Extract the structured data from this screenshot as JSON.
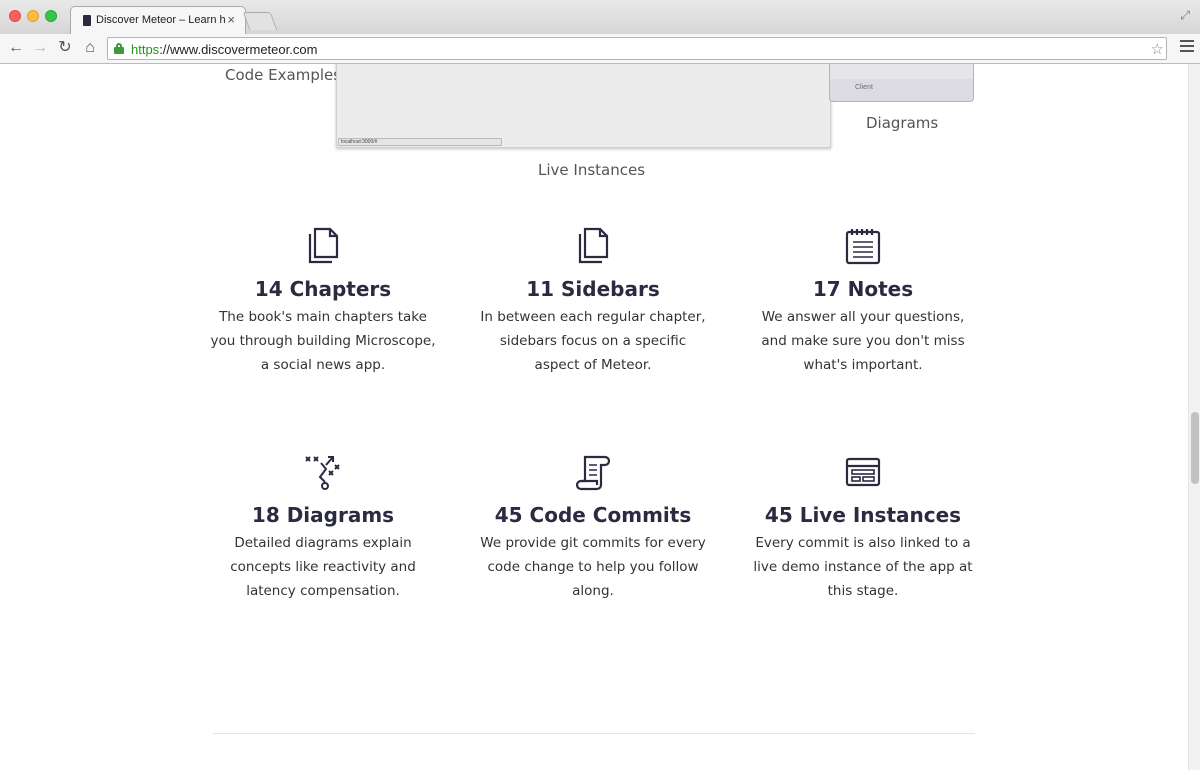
{
  "browser": {
    "tab_title": "Discover Meteor – Learn how",
    "url_scheme": "https",
    "url_rest": "://www.discovermeteor.com"
  },
  "previews": {
    "code_examples": "Code Examples",
    "diagrams": "Diagrams",
    "live_instances": "Live Instances",
    "live_status": "localhost:3000/#",
    "diagram_client": "Client"
  },
  "features": [
    {
      "icon": "pages-icon",
      "title": "14 Chapters",
      "desc": "The book's main chapters take you through building Microscope, a social news app."
    },
    {
      "icon": "page-icon",
      "title": "11 Sidebars",
      "desc": "In between each regular chapter, sidebars focus on a specific aspect of Meteor."
    },
    {
      "icon": "notepad-icon",
      "title": "17 Notes",
      "desc": "We answer all your questions, and make sure you don't miss what's important."
    },
    {
      "icon": "playbook-icon",
      "title": "18 Diagrams",
      "desc": "Detailed diagrams explain concepts like reactivity and latency compensation."
    },
    {
      "icon": "scroll-icon",
      "title": "45 Code Commits",
      "desc": "We provide git commits for every code change to help you follow along."
    },
    {
      "icon": "browser-window-icon",
      "title": "45 Live Instances",
      "desc": "Every commit is also linked to a live demo instance of the app at this stage."
    }
  ],
  "colors": {
    "accent": "#2a2a40"
  }
}
